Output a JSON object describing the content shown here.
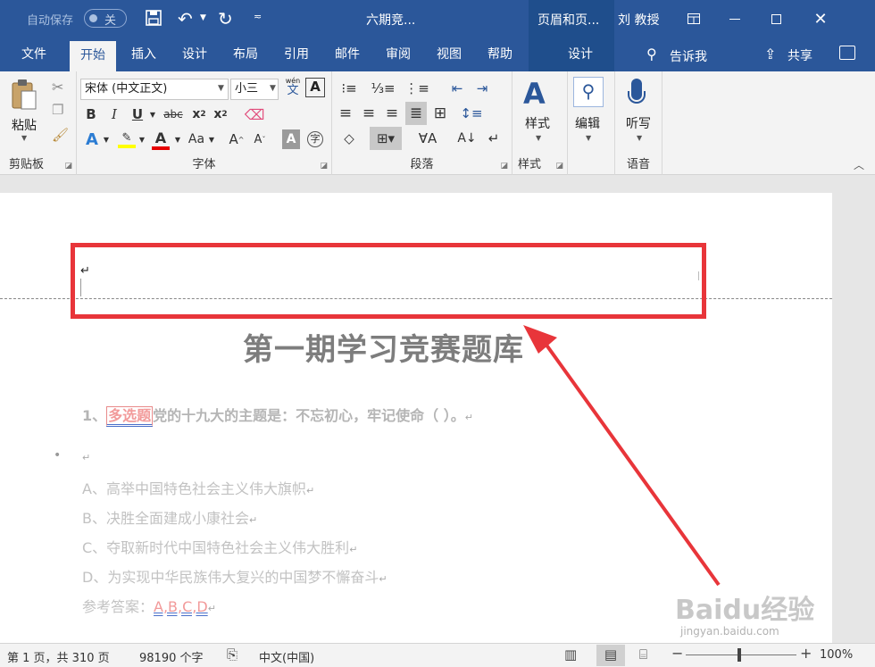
{
  "titlebar": {
    "autosave_label": "自动保存",
    "autosave_state": "关",
    "doc_title": "六期竞...",
    "context_title": "页眉和页...",
    "user": "刘 教授"
  },
  "tabs": {
    "file": "文件",
    "home": "开始",
    "insert": "插入",
    "design": "设计",
    "layout": "布局",
    "references": "引用",
    "mailings": "邮件",
    "review": "审阅",
    "view": "视图",
    "help": "帮助",
    "ctx_design": "设计",
    "tell_me": "告诉我",
    "share": "共享"
  },
  "ribbon": {
    "clipboard": {
      "paste": "粘贴",
      "label": "剪贴板"
    },
    "font": {
      "name": "宋体 (中文正文)",
      "size": "小三",
      "label": "字体",
      "wen": "wén",
      "wen_char": "文",
      "aa": "Aa"
    },
    "paragraph": {
      "label": "段落"
    },
    "styles": {
      "btn": "样式",
      "label": "样式"
    },
    "editing": {
      "btn": "编辑"
    },
    "voice": {
      "btn": "听写",
      "label": "语音"
    }
  },
  "document": {
    "header_mark": "↵",
    "title": "第一期学习竞赛题库",
    "q1_num": "1、",
    "q1_tag": "多选题",
    "q1_text": "党的十九大的主题是：不忘初心，牢记使命（ ）。",
    "bullet_mark": "↵",
    "options": [
      "A、高举中国特色社会主义伟大旗帜",
      "B、决胜全面建成小康社会",
      "C、夺取新时代中国特色社会主义伟大胜利",
      "D、为实现中华民族伟大复兴的中国梦不懈奋斗"
    ],
    "answer_label": "参考答案：",
    "answer_value": "A,B,C,D"
  },
  "watermark": {
    "brand": "Baidu经验",
    "url": "jingyan.baidu.com"
  },
  "status": {
    "page": "第 1 页，共 310 页",
    "words": "98190 个字",
    "language": "中文(中国)",
    "zoom": "100%"
  },
  "colors": {
    "ribbon_blue": "#2b579a",
    "highlight_red": "#e8353a"
  }
}
